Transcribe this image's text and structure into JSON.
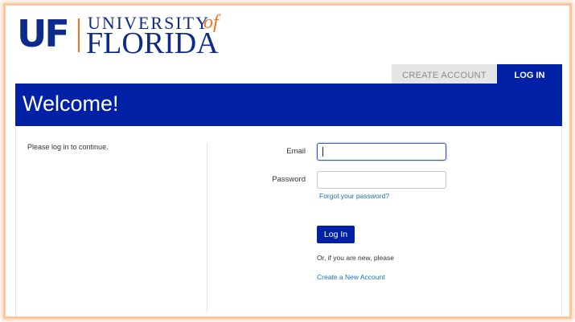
{
  "logo": {
    "uf": "UF",
    "university": "UNIVERSITY",
    "of": "of",
    "florida": "FLORIDA",
    "colors": {
      "blue": "#0e2a8a",
      "orange": "#f37021"
    }
  },
  "tabs": [
    {
      "label": "CREATE ACCOUNT",
      "active": false
    },
    {
      "label": "LOG IN",
      "active": true
    }
  ],
  "banner": {
    "title": "Welcome!",
    "color": "#0021a5"
  },
  "intro_text": "Please log in to continue.",
  "form": {
    "email_label": "Email",
    "email_value": "",
    "password_label": "Password",
    "password_value": "",
    "forgot_link": "Forgot your password?",
    "login_button": "Log In",
    "new_user_text": "Or, if you are new, please",
    "create_link": "Create a New Account"
  }
}
